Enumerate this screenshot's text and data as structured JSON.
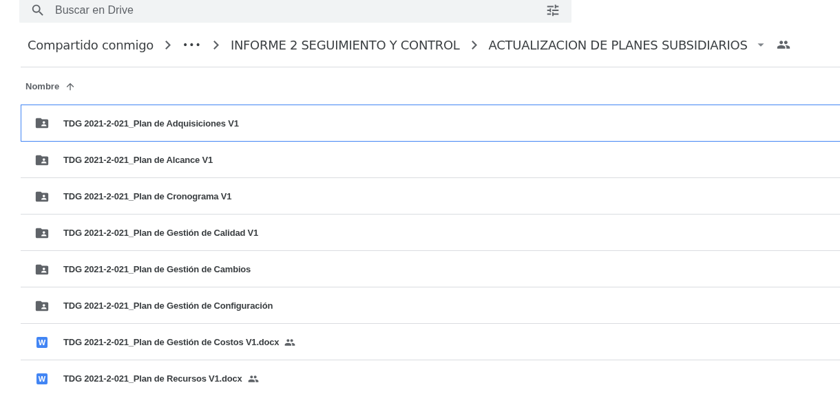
{
  "search": {
    "placeholder": "Buscar en Drive"
  },
  "breadcrumb": [
    {
      "label": "Compartido conmigo",
      "kind": "link"
    },
    {
      "label": "•••",
      "kind": "more"
    },
    {
      "label": "INFORME 2 SEGUIMIENTO Y CONTROL",
      "kind": "link"
    },
    {
      "label": "ACTUALIZACION DE PLANES SUBSIDIARIOS",
      "kind": "current"
    }
  ],
  "sort_header": {
    "label": "Nombre"
  },
  "files": [
    {
      "name": "TDG 2021-2-021_Plan de Adquisiciones V1",
      "kind": "shared-folder",
      "shared": false,
      "selected": true
    },
    {
      "name": "TDG 2021-2-021_Plan de Alcance V1",
      "kind": "shared-folder",
      "shared": false,
      "selected": false
    },
    {
      "name": "TDG 2021-2-021_Plan de Cronograma V1",
      "kind": "shared-folder",
      "shared": false,
      "selected": false
    },
    {
      "name": "TDG 2021-2-021_Plan de Gestión de Calidad V1",
      "kind": "shared-folder",
      "shared": false,
      "selected": false
    },
    {
      "name": "TDG 2021-2-021_Plan de Gestión de Cambios",
      "kind": "shared-folder",
      "shared": false,
      "selected": false
    },
    {
      "name": "TDG 2021-2-021_Plan de Gestión de Configuración",
      "kind": "shared-folder",
      "shared": false,
      "selected": false
    },
    {
      "name": "TDG 2021-2-021_Plan de Gestión de Costos V1.docx",
      "kind": "word",
      "icon_letter": "W",
      "shared": true,
      "selected": false
    },
    {
      "name": "TDG 2021-2-021_Plan de Recursos V1.docx",
      "kind": "word",
      "icon_letter": "W",
      "shared": true,
      "selected": false
    }
  ]
}
